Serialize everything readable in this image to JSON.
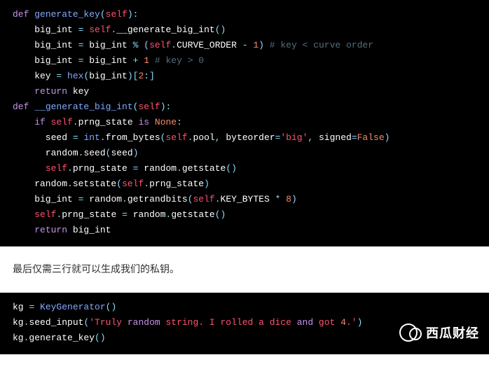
{
  "code1": {
    "lines": [
      [
        [
          "kw",
          "def "
        ],
        [
          "fn",
          "generate_key"
        ],
        [
          "op",
          "("
        ],
        [
          "self",
          "self"
        ],
        [
          "op",
          "):"
        ]
      ],
      [
        [
          "plain",
          "    big_int "
        ],
        [
          "op",
          "= "
        ],
        [
          "self",
          "self"
        ],
        [
          "op",
          "."
        ],
        [
          "prop",
          "__generate_big_int"
        ],
        [
          "op",
          "()"
        ]
      ],
      [
        [
          "plain",
          "    big_int "
        ],
        [
          "op",
          "= "
        ],
        [
          "plain",
          "big_int "
        ],
        [
          "op",
          "% ("
        ],
        [
          "self",
          "self"
        ],
        [
          "op",
          "."
        ],
        [
          "prop",
          "CURVE_ORDER"
        ],
        [
          "op",
          " - "
        ],
        [
          "num",
          "1"
        ],
        [
          "op",
          ") "
        ],
        [
          "cmt",
          "# key < curve order"
        ]
      ],
      [
        [
          "plain",
          "    big_int "
        ],
        [
          "op",
          "= "
        ],
        [
          "plain",
          "big_int "
        ],
        [
          "op",
          "+ "
        ],
        [
          "num",
          "1"
        ],
        [
          "plain",
          " "
        ],
        [
          "cmt",
          "# key > 0"
        ]
      ],
      [
        [
          "plain",
          "    key "
        ],
        [
          "op",
          "= "
        ],
        [
          "fn",
          "hex"
        ],
        [
          "op",
          "("
        ],
        [
          "plain",
          "big_int"
        ],
        [
          "op",
          ")["
        ],
        [
          "num",
          "2"
        ],
        [
          "op",
          ":]"
        ]
      ],
      [
        [
          "plain",
          "    "
        ],
        [
          "kw",
          "return"
        ],
        [
          "plain",
          " key"
        ]
      ],
      [
        [
          "kw",
          "def "
        ],
        [
          "fn",
          "__generate_big_int"
        ],
        [
          "op",
          "("
        ],
        [
          "self",
          "self"
        ],
        [
          "op",
          "):"
        ]
      ],
      [
        [
          "plain",
          "    "
        ],
        [
          "kw",
          "if "
        ],
        [
          "self",
          "self"
        ],
        [
          "op",
          "."
        ],
        [
          "prop",
          "prng_state"
        ],
        [
          "plain",
          " "
        ],
        [
          "kw",
          "is"
        ],
        [
          "plain",
          " "
        ],
        [
          "bool",
          "None"
        ],
        [
          "op",
          ":"
        ]
      ],
      [
        [
          "plain",
          "      seed "
        ],
        [
          "op",
          "= "
        ],
        [
          "fn",
          "int"
        ],
        [
          "op",
          "."
        ],
        [
          "prop",
          "from_bytes"
        ],
        [
          "op",
          "("
        ],
        [
          "self",
          "self"
        ],
        [
          "op",
          "."
        ],
        [
          "prop",
          "pool"
        ],
        [
          "op",
          ", "
        ],
        [
          "plain",
          "byteorder"
        ],
        [
          "op",
          "="
        ],
        [
          "str",
          "'big'"
        ],
        [
          "op",
          ", "
        ],
        [
          "plain",
          "signed"
        ],
        [
          "op",
          "="
        ],
        [
          "bool",
          "False"
        ],
        [
          "op",
          ")"
        ]
      ],
      [
        [
          "plain",
          "      random"
        ],
        [
          "op",
          "."
        ],
        [
          "prop",
          "seed"
        ],
        [
          "op",
          "("
        ],
        [
          "plain",
          "seed"
        ],
        [
          "op",
          ")"
        ]
      ],
      [
        [
          "plain",
          "      "
        ],
        [
          "self",
          "self"
        ],
        [
          "op",
          "."
        ],
        [
          "prop",
          "prng_state"
        ],
        [
          "plain",
          " "
        ],
        [
          "op",
          "= "
        ],
        [
          "plain",
          "random"
        ],
        [
          "op",
          "."
        ],
        [
          "prop",
          "getstate"
        ],
        [
          "op",
          "()"
        ]
      ],
      [
        [
          "plain",
          "    random"
        ],
        [
          "op",
          "."
        ],
        [
          "prop",
          "setstate"
        ],
        [
          "op",
          "("
        ],
        [
          "self",
          "self"
        ],
        [
          "op",
          "."
        ],
        [
          "prop",
          "prng_state"
        ],
        [
          "op",
          ")"
        ]
      ],
      [
        [
          "plain",
          "    big_int "
        ],
        [
          "op",
          "= "
        ],
        [
          "plain",
          "random"
        ],
        [
          "op",
          "."
        ],
        [
          "prop",
          "getrandbits"
        ],
        [
          "op",
          "("
        ],
        [
          "self",
          "self"
        ],
        [
          "op",
          "."
        ],
        [
          "prop",
          "KEY_BYTES"
        ],
        [
          "plain",
          " "
        ],
        [
          "op",
          "* "
        ],
        [
          "num",
          "8"
        ],
        [
          "op",
          ")"
        ]
      ],
      [
        [
          "plain",
          "    "
        ],
        [
          "self",
          "self"
        ],
        [
          "op",
          "."
        ],
        [
          "prop",
          "prng_state"
        ],
        [
          "plain",
          " "
        ],
        [
          "op",
          "= "
        ],
        [
          "plain",
          "random"
        ],
        [
          "op",
          "."
        ],
        [
          "prop",
          "getstate"
        ],
        [
          "op",
          "()"
        ]
      ],
      [
        [
          "plain",
          "    "
        ],
        [
          "kw",
          "return"
        ],
        [
          "plain",
          " big_int"
        ]
      ]
    ]
  },
  "article": {
    "between_text": "最后仅需三行就可以生成我们的私钥。"
  },
  "code2": {
    "lines": [
      [
        [
          "plain",
          "kg "
        ],
        [
          "op",
          "= "
        ],
        [
          "fn",
          "KeyGenerator"
        ],
        [
          "op",
          "()"
        ]
      ],
      [
        [
          "plain",
          "kg"
        ],
        [
          "op",
          "."
        ],
        [
          "prop",
          "seed_input"
        ],
        [
          "op",
          "("
        ],
        [
          "str",
          "'Truly "
        ],
        [
          "kw",
          "random"
        ],
        [
          "str",
          " string. I rolled a dice "
        ],
        [
          "kw",
          "and"
        ],
        [
          "str",
          " got "
        ],
        [
          "num",
          "4"
        ],
        [
          "str",
          ".'"
        ],
        [
          "op",
          ")"
        ]
      ],
      [
        [
          "plain",
          "kg"
        ],
        [
          "op",
          "."
        ],
        [
          "prop",
          "generate_key"
        ],
        [
          "op",
          "()"
        ]
      ]
    ]
  },
  "watermark": {
    "text": "西瓜财经"
  }
}
